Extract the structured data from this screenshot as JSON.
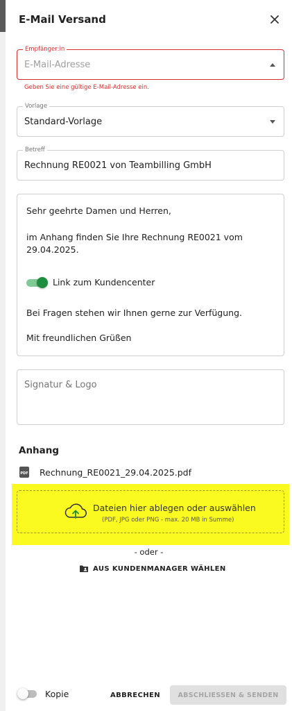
{
  "dialog": {
    "title": "E-Mail Versand"
  },
  "recipient": {
    "label": "Empfänger:in",
    "placeholder": "E-Mail-Adresse",
    "error": "Geben Sie eine gültige E-Mail-Adresse ein."
  },
  "template": {
    "label": "Vorlage",
    "value": "Standard-Vorlage"
  },
  "subject": {
    "label": "Betreff",
    "value": "Rechnung RE0021 von Teambilling GmbH"
  },
  "body": {
    "greeting": "Sehr geehrte Damen und Herren,",
    "intro": "im Anhang finden Sie Ihre Rechnung RE0021 vom 29.04.2025.",
    "link_toggle_label": "Link zum Kundencenter",
    "link_toggle_on": true,
    "questions": "Bei Fragen stehen wir Ihnen gerne zur Verfügung.",
    "closing": "Mit freundlichen Grüßen"
  },
  "signature": {
    "placeholder": "Signatur & Logo"
  },
  "attachments": {
    "title": "Anhang",
    "files": [
      {
        "name": "Rechnung_RE0021_29.04.2025.pdf",
        "icon": "pdf-file-icon",
        "icon_text": "PDF"
      }
    ]
  },
  "dropzone": {
    "main": "Dateien hier ablegen oder auswählen",
    "sub": "(PDF, JPG oder PNG - max. 20 MB in Summe)",
    "icon": "cloud-upload-icon"
  },
  "alt": {
    "or_text": "- oder -",
    "customer_manager": "AUS KUNDENMANAGER WÄHLEN",
    "customer_manager_icon": "folder-account-icon"
  },
  "footer": {
    "copy_label": "Kopie",
    "copy_on": false,
    "cancel": "ABBRECHEN",
    "submit": "ABSCHLIESSEN & SENDEN"
  },
  "colors": {
    "error": "#d32f2f",
    "toggle_on": "#1e8e3e",
    "dropzone_highlight": "#fafa20",
    "upload_arrow": "#1e8e3e"
  }
}
